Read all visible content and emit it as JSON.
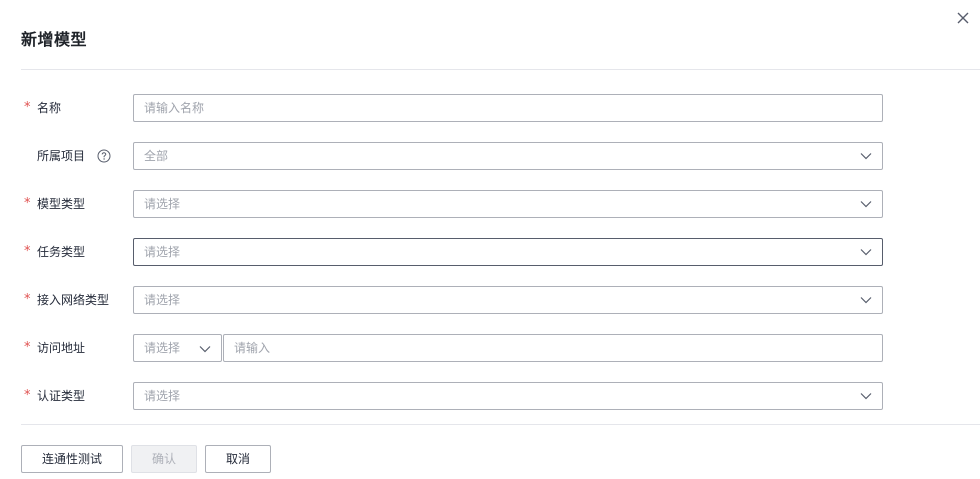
{
  "dialog": {
    "title": "新增模型"
  },
  "form": {
    "required_mark": "*",
    "name": {
      "label": "名称",
      "placeholder": "请输入名称"
    },
    "project": {
      "label": "所属项目",
      "value": "全部"
    },
    "model_type": {
      "label": "模型类型",
      "placeholder": "请选择"
    },
    "task_type": {
      "label": "任务类型",
      "placeholder": "请选择"
    },
    "network_type": {
      "label": "接入网络类型",
      "placeholder": "请选择"
    },
    "access_address": {
      "label": "访问地址",
      "select_placeholder": "请选择",
      "input_placeholder": "请输入"
    },
    "auth_type": {
      "label": "认证类型",
      "placeholder": "请选择"
    }
  },
  "footer": {
    "test_label": "连通性测试",
    "confirm_label": "确认",
    "cancel_label": "取消"
  },
  "icons": {
    "close": "close-icon",
    "help": "question-circle-icon",
    "chevron": "chevron-down-icon"
  },
  "colors": {
    "required": "#e0504f",
    "placeholder": "#a0a4ad",
    "border": "#adb0b8",
    "focused_border": "#575d6c",
    "disabled_bg": "#f0f1f3"
  }
}
